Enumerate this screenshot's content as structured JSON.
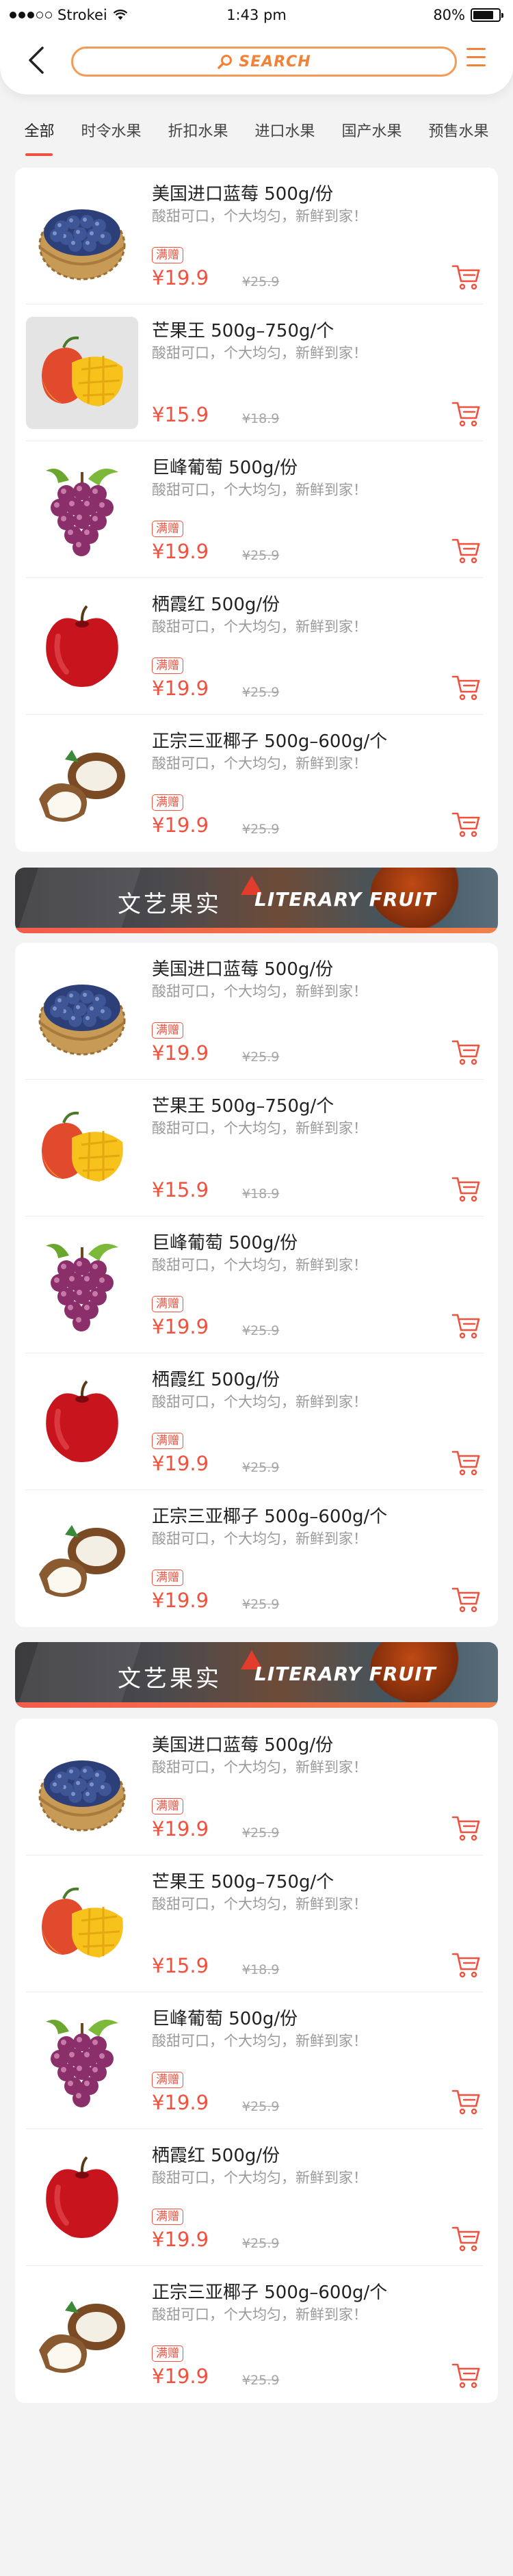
{
  "status_bar": {
    "carrier": "Strokei",
    "time": "1:43 pm",
    "battery": "80%",
    "battery_level": 0.8
  },
  "header": {
    "search_label": "SEARCH"
  },
  "tabs": [
    "全部",
    "时令水果",
    "折扣水果",
    "进口水果",
    "国产水果",
    "预售水果"
  ],
  "active_tab": 0,
  "banner": {
    "cn": "文艺果实",
    "en": "LITERARY FRUIT"
  },
  "sections": [
    {
      "items": [
        {
          "fruit": "blueberry",
          "title": "美国进口蓝莓 500g/份",
          "desc": "酸甜可口，个大均匀，新鲜到家！",
          "tag": "满赠",
          "price": "¥19.9",
          "old_price": "¥25.9"
        },
        {
          "fruit": "mango",
          "title": "芒果王 500g–750g/个",
          "desc": "酸甜可口，个大均匀，新鲜到家！",
          "tag": "",
          "price": "¥15.9",
          "old_price": "¥18.9",
          "grey_bg": true
        },
        {
          "fruit": "grape",
          "title": "巨峰葡萄 500g/份",
          "desc": "酸甜可口，个大均匀，新鲜到家！",
          "tag": "满赠",
          "price": "¥19.9",
          "old_price": "¥25.9"
        },
        {
          "fruit": "apple",
          "title": "栖霞红 500g/份",
          "desc": "酸甜可口，个大均匀，新鲜到家！",
          "tag": "满赠",
          "price": "¥19.9",
          "old_price": "¥25.9"
        },
        {
          "fruit": "coconut",
          "title": "正宗三亚椰子 500g–600g/个",
          "desc": "酸甜可口，个大均匀，新鲜到家！",
          "tag": "满赠",
          "price": "¥19.9",
          "old_price": "¥25.9"
        }
      ]
    },
    {
      "items": [
        {
          "fruit": "blueberry",
          "title": "美国进口蓝莓 500g/份",
          "desc": "酸甜可口，个大均匀，新鲜到家！",
          "tag": "满赠",
          "price": "¥19.9",
          "old_price": "¥25.9"
        },
        {
          "fruit": "mango",
          "title": "芒果王 500g–750g/个",
          "desc": "酸甜可口，个大均匀，新鲜到家！",
          "tag": "",
          "price": "¥15.9",
          "old_price": "¥18.9"
        },
        {
          "fruit": "grape",
          "title": "巨峰葡萄 500g/份",
          "desc": "酸甜可口，个大均匀，新鲜到家！",
          "tag": "满赠",
          "price": "¥19.9",
          "old_price": "¥25.9"
        },
        {
          "fruit": "apple",
          "title": "栖霞红 500g/份",
          "desc": "酸甜可口，个大均匀，新鲜到家！",
          "tag": "满赠",
          "price": "¥19.9",
          "old_price": "¥25.9"
        },
        {
          "fruit": "coconut",
          "title": "正宗三亚椰子 500g–600g/个",
          "desc": "酸甜可口，个大均匀，新鲜到家！",
          "tag": "满赠",
          "price": "¥19.9",
          "old_price": "¥25.9"
        }
      ]
    },
    {
      "items": [
        {
          "fruit": "blueberry",
          "title": "美国进口蓝莓 500g/份",
          "desc": "酸甜可口，个大均匀，新鲜到家！",
          "tag": "满赠",
          "price": "¥19.9",
          "old_price": "¥25.9"
        },
        {
          "fruit": "mango",
          "title": "芒果王 500g–750g/个",
          "desc": "酸甜可口，个大均匀，新鲜到家！",
          "tag": "",
          "price": "¥15.9",
          "old_price": "¥18.9"
        },
        {
          "fruit": "grape",
          "title": "巨峰葡萄 500g/份",
          "desc": "酸甜可口，个大均匀，新鲜到家！",
          "tag": "满赠",
          "price": "¥19.9",
          "old_price": "¥25.9"
        },
        {
          "fruit": "apple",
          "title": "栖霞红 500g/份",
          "desc": "酸甜可口，个大均匀，新鲜到家！",
          "tag": "满赠",
          "price": "¥19.9",
          "old_price": "¥25.9"
        },
        {
          "fruit": "coconut",
          "title": "正宗三亚椰子 500g–600g/个",
          "desc": "酸甜可口，个大均匀，新鲜到家！",
          "tag": "满赠",
          "price": "¥19.9",
          "old_price": "¥25.9"
        }
      ]
    }
  ],
  "colors": {
    "accent": "#f0523f",
    "search": "#f0823a"
  }
}
